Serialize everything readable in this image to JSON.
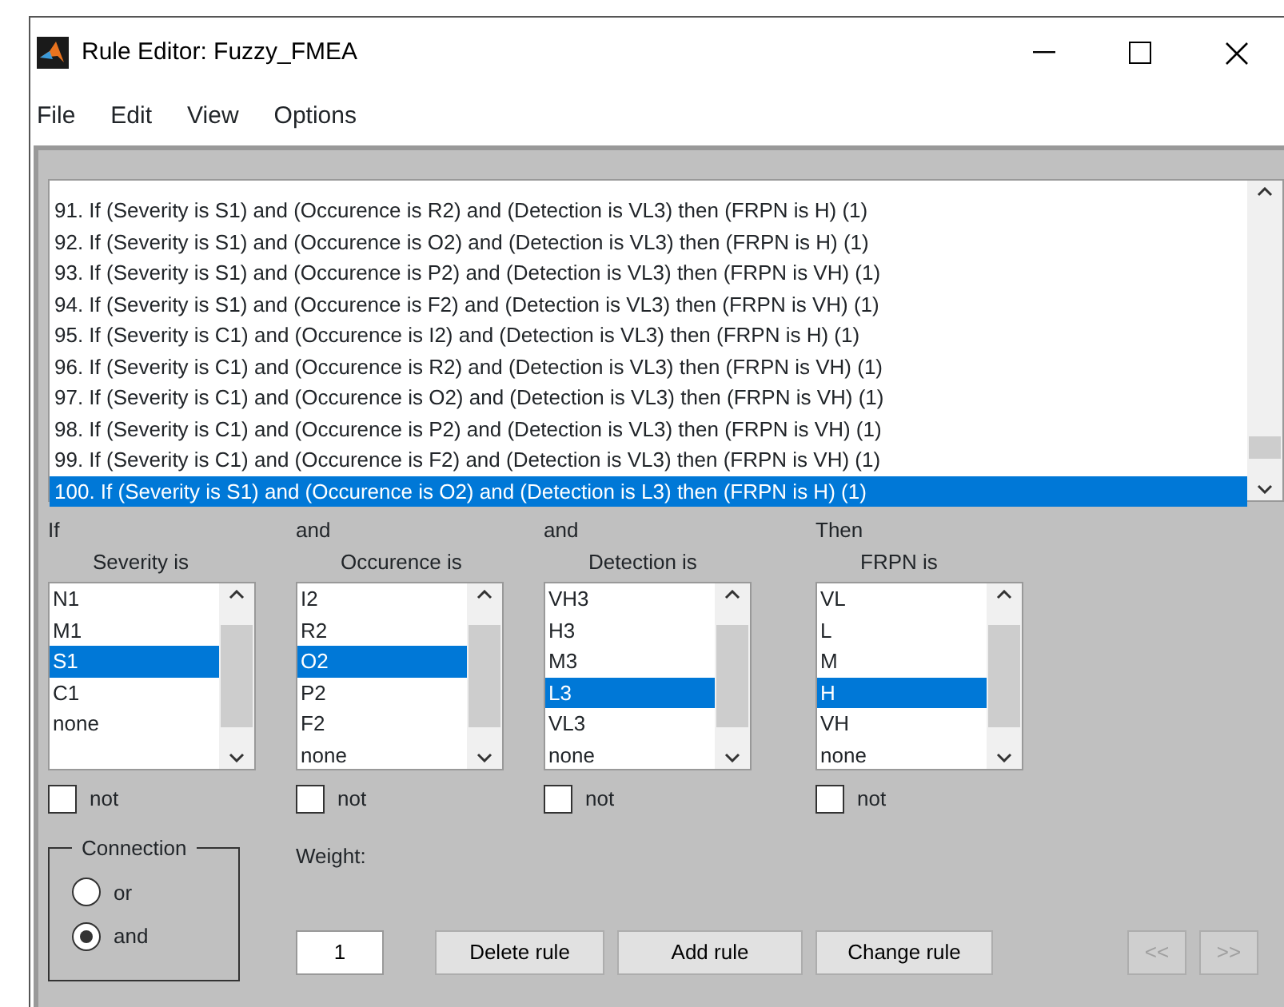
{
  "window": {
    "title": "Rule Editor: Fuzzy_FMEA"
  },
  "menu": [
    "File",
    "Edit",
    "View",
    "Options"
  ],
  "rules": [
    {
      "text": "91. If (Severity is S1) and (Occurence is R2) and (Detection is VL3) then (FRPN is H) (1)",
      "selected": false
    },
    {
      "text": "92. If (Severity is S1) and (Occurence is O2) and (Detection is VL3) then (FRPN is H) (1)",
      "selected": false
    },
    {
      "text": "93. If (Severity is S1) and (Occurence is P2) and (Detection is VL3) then (FRPN is VH) (1)",
      "selected": false
    },
    {
      "text": "94. If (Severity is S1) and (Occurence is F2) and (Detection is VL3) then (FRPN is VH) (1)",
      "selected": false
    },
    {
      "text": "95. If (Severity is C1) and (Occurence is I2) and (Detection is VL3) then (FRPN is H) (1)",
      "selected": false
    },
    {
      "text": "96. If (Severity is C1) and (Occurence is R2) and (Detection is VL3) then (FRPN is VH) (1)",
      "selected": false
    },
    {
      "text": "97. If (Severity is C1) and (Occurence is O2) and (Detection is VL3) then (FRPN is VH) (1)",
      "selected": false
    },
    {
      "text": "98. If (Severity is C1) and (Occurence is P2) and (Detection is VL3) then (FRPN is VH) (1)",
      "selected": false
    },
    {
      "text": "99. If (Severity is C1) and (Occurence is F2) and (Detection is VL3) then (FRPN is VH) (1)",
      "selected": false
    },
    {
      "text": "100. If (Severity is S1) and (Occurence is O2) and (Detection is L3) then (FRPN is H) (1)",
      "selected": true
    }
  ],
  "variables": [
    {
      "kind": "input",
      "connector": "If",
      "label": "Severity is",
      "options": [
        {
          "label": "N1",
          "selected": false
        },
        {
          "label": "M1",
          "selected": false
        },
        {
          "label": "S1",
          "selected": true
        },
        {
          "label": "C1",
          "selected": false
        },
        {
          "label": "none",
          "selected": false
        }
      ],
      "not_label": "not",
      "not_checked": false
    },
    {
      "kind": "input",
      "connector": "and",
      "label": "Occurence is",
      "options": [
        {
          "label": "I2",
          "selected": false
        },
        {
          "label": "R2",
          "selected": false
        },
        {
          "label": "O2",
          "selected": true
        },
        {
          "label": "P2",
          "selected": false
        },
        {
          "label": "F2",
          "selected": false
        },
        {
          "label": "none",
          "selected": false
        }
      ],
      "not_label": "not",
      "not_checked": false
    },
    {
      "kind": "input",
      "connector": "and",
      "label": "Detection is",
      "options": [
        {
          "label": "VH3",
          "selected": false
        },
        {
          "label": "H3",
          "selected": false
        },
        {
          "label": "M3",
          "selected": false
        },
        {
          "label": "L3",
          "selected": true
        },
        {
          "label": "VL3",
          "selected": false
        },
        {
          "label": "none",
          "selected": false
        }
      ],
      "not_label": "not",
      "not_checked": false
    },
    {
      "kind": "output",
      "connector": "Then",
      "label": "FRPN is",
      "options": [
        {
          "label": "VL",
          "selected": false
        },
        {
          "label": "L",
          "selected": false
        },
        {
          "label": "M",
          "selected": false
        },
        {
          "label": "H",
          "selected": true
        },
        {
          "label": "VH",
          "selected": false
        },
        {
          "label": "none",
          "selected": false
        }
      ],
      "not_label": "not",
      "not_checked": false
    }
  ],
  "connection": {
    "title": "Connection",
    "options": [
      {
        "label": "or",
        "selected": false
      },
      {
        "label": "and",
        "selected": true
      }
    ]
  },
  "weight": {
    "label": "Weight:",
    "value": "1"
  },
  "buttons": [
    {
      "label": "Delete rule",
      "disabled": false
    },
    {
      "label": "Add rule",
      "disabled": false
    },
    {
      "label": "Change rule",
      "disabled": false
    }
  ],
  "nav_buttons": [
    {
      "label": "<<",
      "disabled": true
    },
    {
      "label": ">>",
      "disabled": true
    }
  ]
}
